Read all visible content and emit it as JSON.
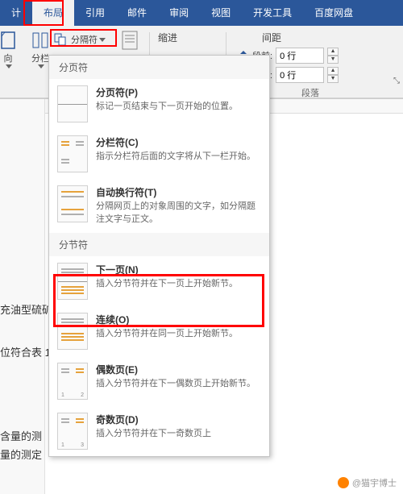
{
  "tabs": {
    "design": "计",
    "layout": "布局",
    "references": "引用",
    "mailings": "邮件",
    "review": "审阅",
    "view": "视图",
    "dev": "开发工具",
    "baidu": "百度网盘"
  },
  "toolbar": {
    "orientation": "向",
    "columns": "分栏",
    "breaks": "分隔符",
    "indent_label": "缩进",
    "spacing_label": "间距",
    "before_label": "段前:",
    "after_label": "段后:",
    "before_value": "0 行",
    "after_value": "0 行",
    "paragraph_group": "段落"
  },
  "dropdown": {
    "sec1": "分页符",
    "page_break": {
      "title": "分页符(P)",
      "desc": "标记一页结束与下一页开始的位置。"
    },
    "column_break": {
      "title": "分栏符(C)",
      "desc": "指示分栏符后面的文字将从下一栏开始。"
    },
    "text_wrap": {
      "title": "自动换行符(T)",
      "desc": "分隔网页上的对象周围的文字，如分隔题注文字与正文。"
    },
    "sec2": "分节符",
    "next_page": {
      "title": "下一页(N)",
      "desc": "插入分节符并在下一页上开始新节。"
    },
    "continuous": {
      "title": "连续(O)",
      "desc": "插入分节符并在同一页上开始新节。"
    },
    "even_page": {
      "title": "偶数页(E)",
      "desc": "插入分节符并在下一偶数页上开始新节。"
    },
    "odd_page": {
      "title": "奇数页(D)",
      "desc": "插入分节符并在下一奇数页上"
    }
  },
  "document": {
    "line1": "充油型硫矿",
    "line2": "位符合表 1",
    "line3": "含量的测",
    "line4": "量的测定"
  },
  "watermark": "@猫宇博士"
}
